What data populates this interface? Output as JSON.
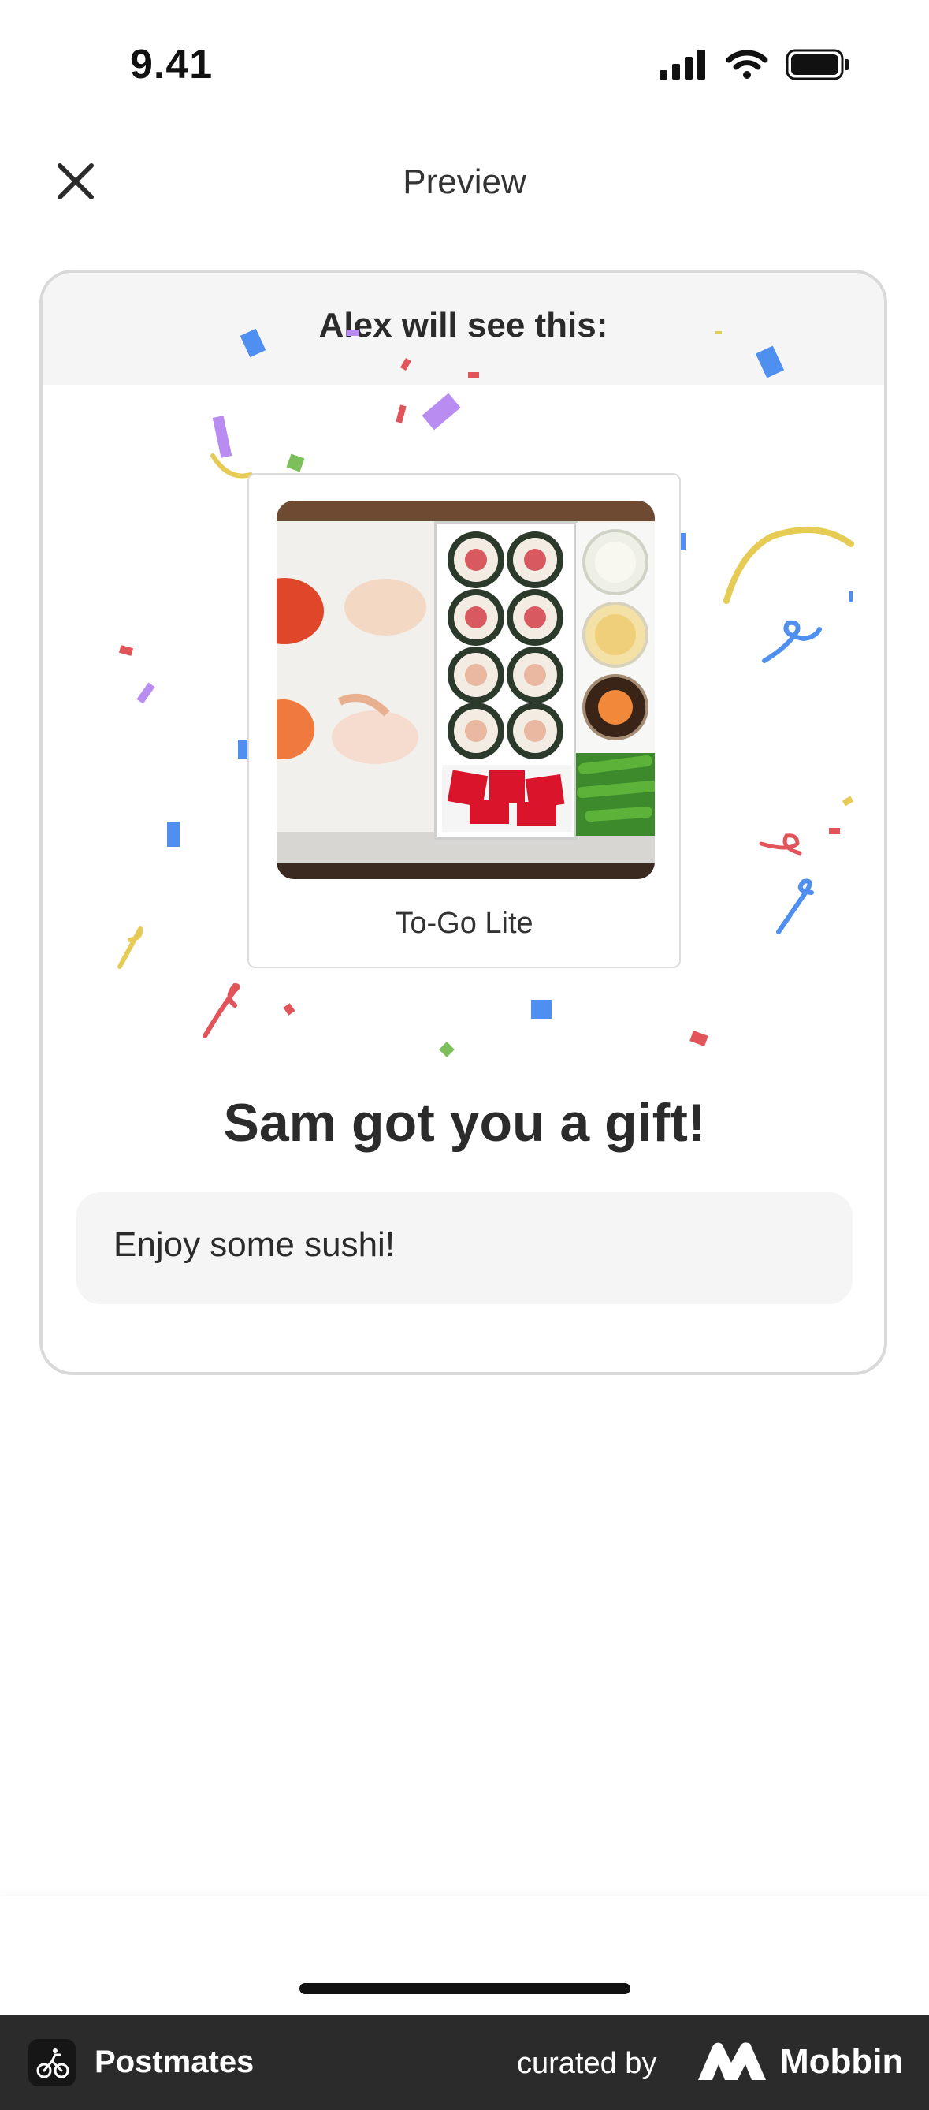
{
  "status_bar": {
    "time": "9.41"
  },
  "header": {
    "title": "Preview",
    "close_icon": "close-icon"
  },
  "card": {
    "heading": "Alex will see this:",
    "gift": {
      "name": "To-Go Lite",
      "image": "sushi-box-image"
    },
    "title": "Sam got you a gift!",
    "message": "Enjoy some sushi!"
  },
  "footer": {
    "app_name": "Postmates",
    "curated_label": "curated by",
    "brand": "Mobbin"
  },
  "colors": {
    "confetti_blue": "#4f8ff0",
    "confetti_purple": "#b88cf0",
    "confetti_red": "#e0545a",
    "confetti_yellow": "#e6cc55",
    "confetti_green": "#7bc05a"
  }
}
